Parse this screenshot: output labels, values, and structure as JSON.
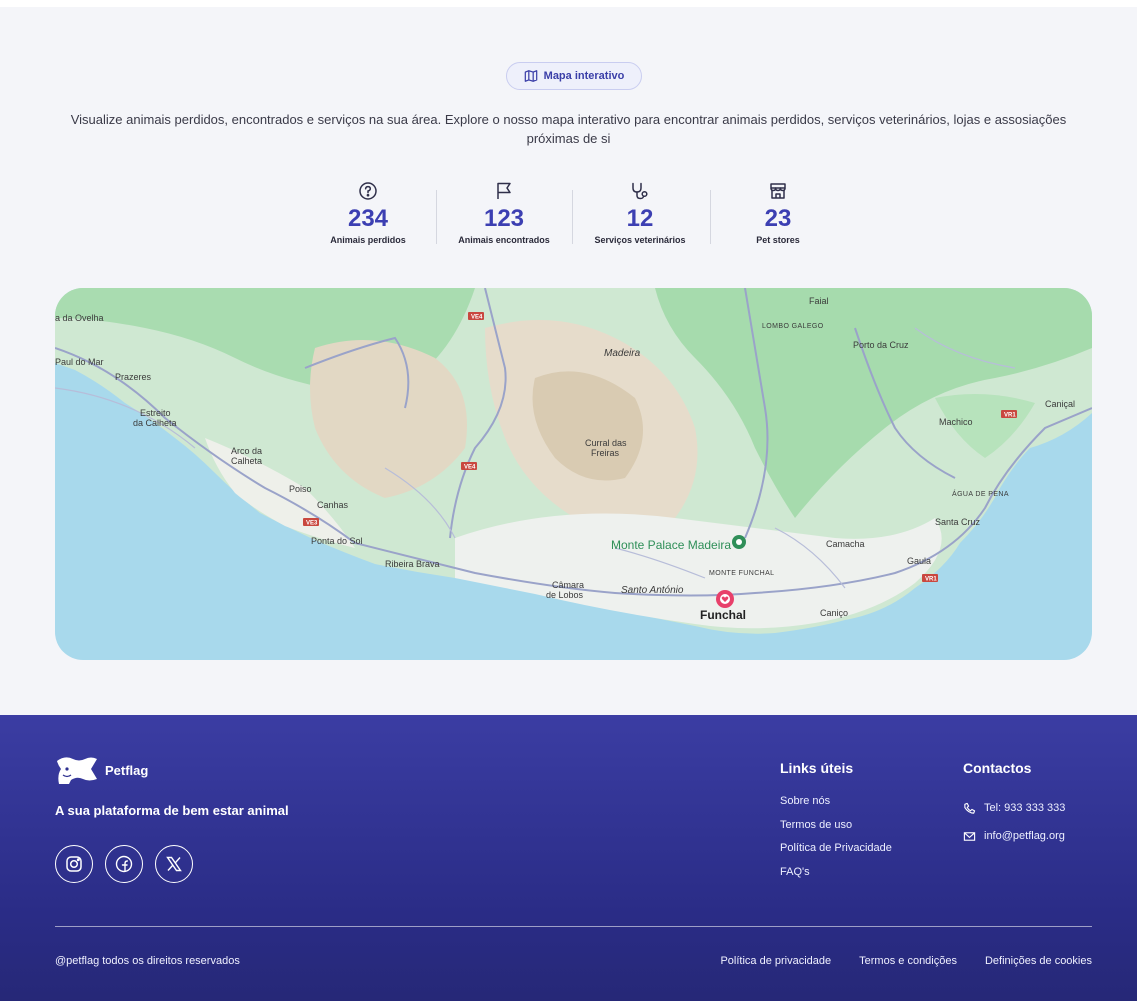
{
  "header": {
    "pill_label": "Mapa interativo",
    "description": "Visualize animais perdidos, encontrados e serviços na sua área. Explore o nosso mapa interativo para encontrar animais perdidos, serviços veterinários, lojas e assosiações próximas de si"
  },
  "stats": [
    {
      "icon": "question-circle-icon",
      "value": "234",
      "label": "Animais perdidos"
    },
    {
      "icon": "flag-icon",
      "value": "123",
      "label": "Animais encontrados"
    },
    {
      "icon": "stethoscope-icon",
      "value": "12",
      "label": "Serviços veterinários"
    },
    {
      "icon": "store-icon",
      "value": "23",
      "label": "Pet stores"
    }
  ],
  "map": {
    "labels": {
      "da_ovelha": "a da Ovelha",
      "paul_do_mar": "Paul do Mar",
      "prazeres": "Prazeres",
      "estreito_1": "Estreito",
      "estreito_2": "da Calheta",
      "arco_1": "Arco da",
      "arco_2": "Calheta",
      "poiso": "Poiso",
      "canhas": "Canhas",
      "ponta_do_sol": "Ponta do Sol",
      "ribeira_brava": "Ribeira Brava",
      "camara_1": "Câmara",
      "camara_2": "de Lobos",
      "santo_antonio": "Santo António",
      "funchal": "Funchal",
      "monte_funchal": "MONTE FUNCHAL",
      "monte_palace": "Monte Palace Madeira",
      "curral_1": "Curral das",
      "curral_2": "Freiras",
      "madeira": "Madeira",
      "lombo_galego": "LOMBO GALEGO",
      "faial": "Faial",
      "porto_da_cruz": "Porto da Cruz",
      "canical": "Caniçal",
      "machico": "Machico",
      "agua_de_pena": "ÁGUA DE PENA",
      "santa_cruz": "Santa Cruz",
      "gaula": "Gaula",
      "camacha": "Camacha",
      "canico": "Caniço"
    },
    "roads": {
      "ve4_a": "VE4",
      "ve4_b": "VE4",
      "ve3": "VE3",
      "vr1_a": "VR1",
      "vr1_b": "VR1"
    }
  },
  "footer": {
    "brand": "Petflag",
    "tagline": "A sua plataforma de bem estar animal",
    "socials": [
      "instagram-icon",
      "facebook-icon",
      "x-icon"
    ],
    "links_title": "Links úteis",
    "links": [
      "Sobre nós",
      "Termos de uso",
      "Política de Privacidade",
      "FAQ's"
    ],
    "contacts_title": "Contactos",
    "phone": "Tel: 933 333 333",
    "email": "info@petflag.org",
    "copyright": "@petflag todos os direitos reservados",
    "bottom_links": [
      "Política de privacidade",
      "Termos e condições",
      "Definições de cookies"
    ]
  },
  "colors": {
    "accent": "#3c3fb2",
    "footer_bg": "#2f3190",
    "page_bg": "#f4f5f9",
    "sea": "#a8d9ec",
    "pin": "#e8406a"
  }
}
